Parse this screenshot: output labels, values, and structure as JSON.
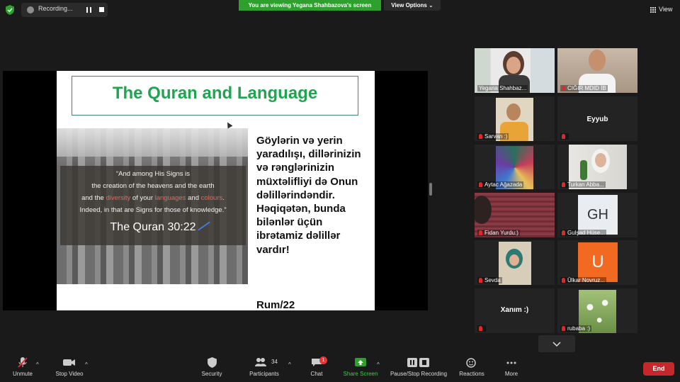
{
  "recording": {
    "label": "Recording..."
  },
  "banner": {
    "viewing": "You are viewing Yegana Shahbazova's screen",
    "view_options": "View Options ⌄"
  },
  "view_button": "View",
  "slide": {
    "title": "The Quran and Language",
    "quote_lines": [
      "“And among His Signs is",
      "the creation of the heavens and the earth"
    ],
    "quote_line3": {
      "a": "and the ",
      "b": "diversity",
      "c": " of your ",
      "d": "languages",
      "e": " and ",
      "f": "colours",
      "g": "."
    },
    "quote_line4": "Indeed, in that are Signs for those of knowledge.”",
    "reference": "The Quran 30:22",
    "translation": "Göylərin və yerin yaradılışı, dillərinizin və rənglərinizin müxtəlifliyi də Onun dəlillərindəndir. Həqiqətən, bunda bilənlər üçün ibrətamiz dəlillər vardır!",
    "source": "Rum/22"
  },
  "participants": [
    {
      "name": "Yegana Shahbaz...",
      "muted": false
    },
    {
      "name": "CIĞIR MDID İB",
      "muted": true
    },
    {
      "name": "Sarvan :)",
      "muted": true
    },
    {
      "name": "Eyyub",
      "muted": true,
      "center_label": "Eyyub"
    },
    {
      "name": "Aytac Ağazada",
      "muted": true
    },
    {
      "name": "Turkan Abba...",
      "muted": true
    },
    {
      "name": "Fidan Yurdu:)",
      "muted": true
    },
    {
      "name": "Gulşad Hüse...",
      "muted": true,
      "initials": "GH"
    },
    {
      "name": "Sevda",
      "muted": true
    },
    {
      "name": "Ülkar Novruz...",
      "muted": true,
      "initials": "U"
    },
    {
      "name": "Xanım :)",
      "muted": true,
      "center_label": "Xanım :)"
    },
    {
      "name": "rubaba :)",
      "muted": true
    }
  ],
  "toolbar": {
    "unmute": "Unmute",
    "stop_video": "Stop Video",
    "security": "Security",
    "participants": "Participants",
    "participants_count": "34",
    "chat": "Chat",
    "chat_badge": "1",
    "share_screen": "Share Screen",
    "pause_recording": "Pause/Stop Recording",
    "reactions": "Reactions",
    "more": "More",
    "end": "End"
  },
  "colors": {
    "banner_green": "#2ea02e",
    "active_speaker": "#b5e33b",
    "end_red": "#c4282a",
    "title_green": "#1fa54f"
  }
}
